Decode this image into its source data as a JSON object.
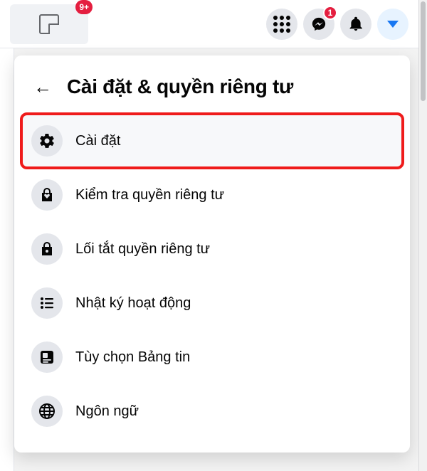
{
  "topbar": {
    "gaming_tab_badge": "9+",
    "messenger_badge": "1"
  },
  "panel": {
    "title": "Cài đặt & quyền riêng tư",
    "items": [
      {
        "id": "settings",
        "label": "Cài đặt",
        "highlight": true
      },
      {
        "id": "privacy-checkup",
        "label": "Kiểm tra quyền riêng tư"
      },
      {
        "id": "privacy-shortcuts",
        "label": "Lối tắt quyền riêng tư"
      },
      {
        "id": "activity-log",
        "label": "Nhật ký hoạt động"
      },
      {
        "id": "news-feed-pref",
        "label": "Tùy chọn Bảng tin"
      },
      {
        "id": "language",
        "label": "Ngôn ngữ"
      }
    ]
  }
}
